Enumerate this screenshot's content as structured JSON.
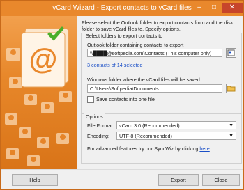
{
  "window": {
    "title": "vCard Wizard - Export contacts to vCard files"
  },
  "titlebar": {
    "minimize": "–",
    "maximize": "□",
    "close": "✕"
  },
  "instructions": "Please select the Outlook folder to export contacts from and the disk folder to save vCard files to. Specify options.",
  "export_group": {
    "legend": "Select folders to export contacts to",
    "outlook_label": "Outlook folder containing contacts to export",
    "outlook_value": "\\\\████@softpedia.com\\Contacts (This computer only)",
    "selected_link": "3 contacts of 14 selected",
    "windows_label": "Windows folder where the vCard files will be saved",
    "windows_value": "C:\\Users\\Softpedia\\Documents",
    "single_file_label": "Save contacts into one file"
  },
  "options_group": {
    "legend": "Options",
    "format_label": "File Format:",
    "format_value": "vCard 3.0 (Recommended)",
    "encoding_label": "Encoding:",
    "encoding_value": "UTF-8 (Recommended)",
    "advanced_text": "For advanced features try our SyncWiz by clicking",
    "advanced_link": "here",
    "advanced_end": "."
  },
  "footer": {
    "help": "Help",
    "export": "Export",
    "close": "Close"
  },
  "colors": {
    "accent": "#e9882c",
    "close_button": "#c7452b",
    "link": "#1a4fc7"
  }
}
